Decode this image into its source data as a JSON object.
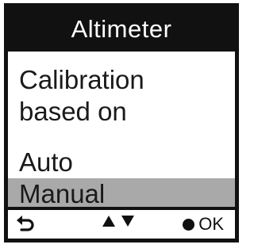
{
  "header": {
    "title": "Altimeter"
  },
  "message": {
    "line1": "Calibration",
    "line2": "based on"
  },
  "options": [
    {
      "label": "Auto",
      "selected": false
    },
    {
      "label": "Manual",
      "selected": true
    }
  ],
  "footer": {
    "back_icon": "back-arrow-icon",
    "nav_icons": [
      "triangle-up-icon",
      "triangle-down-icon"
    ],
    "ok_icon": "filled-circle-icon",
    "ok_label": "OK"
  },
  "colors": {
    "frame": "#111111",
    "selection": "#a9a9a9",
    "background": "#ffffff"
  }
}
